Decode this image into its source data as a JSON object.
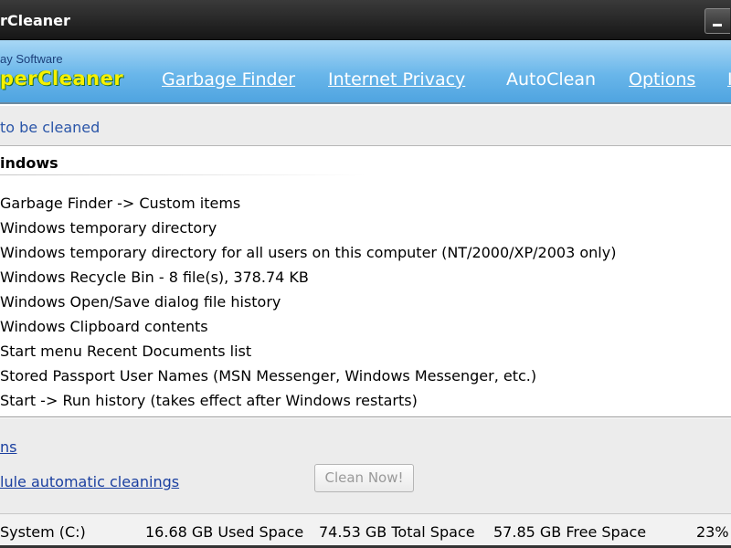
{
  "window": {
    "title": "rCleaner"
  },
  "header": {
    "company": "ay Software",
    "logo": "perCleaner",
    "nav": [
      {
        "label": "Garbage Finder"
      },
      {
        "label": "Internet Privacy"
      },
      {
        "label": "AutoClean"
      },
      {
        "label": "Options"
      },
      {
        "label": "I"
      }
    ]
  },
  "subheader": {
    "label": "to be cleaned"
  },
  "list": {
    "section_title": "indows",
    "items": [
      "Garbage Finder -> Custom items",
      "Windows temporary directory",
      "Windows temporary directory for all users on this computer (NT/2000/XP/2003 only)",
      "Windows Recycle Bin - 8 file(s), 378.74 KB",
      "Windows Open/Save dialog file history",
      "Windows Clipboard contents",
      "Start menu Recent Documents list",
      "Stored Passport User Names (MSN Messenger, Windows Messenger, etc.)",
      "Start -> Run history (takes effect after Windows restarts)"
    ]
  },
  "bottom": {
    "options_link": "ns",
    "schedule_link": "lule automatic cleanings",
    "clean_button": "Clean Now!"
  },
  "status": {
    "drive": "System (C:)",
    "used": "16.68 GB Used Space",
    "total": "74.53 GB Total Space",
    "free": "57.85 GB Free Space",
    "percent": "23%"
  }
}
